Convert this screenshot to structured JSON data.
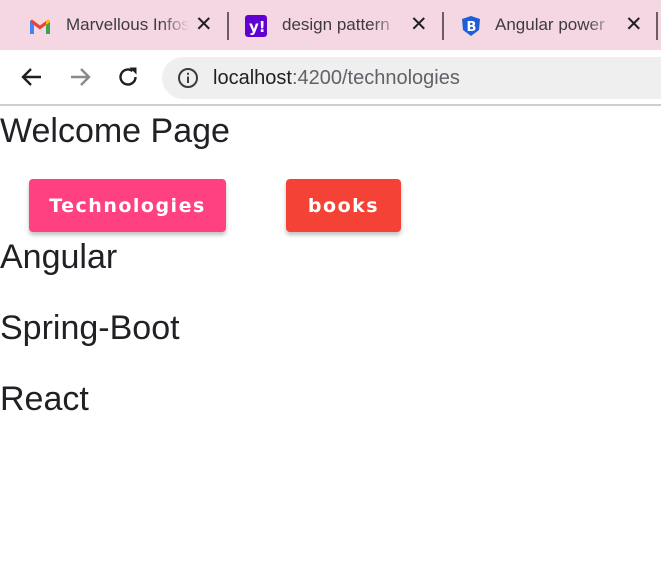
{
  "browser": {
    "tabs": [
      {
        "title": "Marvellous Infosystems",
        "favicon": "gmail-icon"
      },
      {
        "title": "design pattern",
        "favicon": "yahoo-icon"
      },
      {
        "title": "Angular power",
        "favicon": "shield-b-icon"
      }
    ],
    "address": {
      "host": "localhost",
      "port_path": ":4200/technologies"
    }
  },
  "page": {
    "title": "Welcome Page",
    "buttons": {
      "technologies": "Technologies",
      "books": "books"
    },
    "technologies": [
      "Angular",
      "Spring-Boot",
      "React"
    ]
  },
  "colors": {
    "tab_strip": "#f5d6e3",
    "technologies_button": "#ff4081",
    "books_button": "#f44336"
  }
}
